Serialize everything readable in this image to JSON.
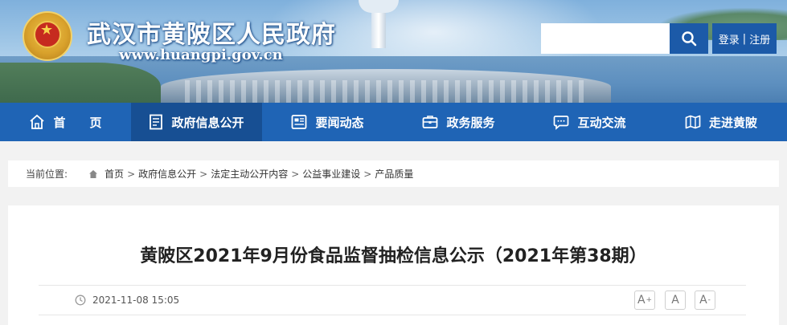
{
  "header": {
    "site_title": "武汉市黄陂区人民政府",
    "site_url": "www.huangpi.gov.cn",
    "search": {
      "value": "",
      "placeholder": ""
    },
    "login_label": "登录",
    "separator": "|",
    "register_label": "注册"
  },
  "nav": {
    "items": [
      {
        "label": "首页",
        "icon": "home-icon",
        "active": false
      },
      {
        "label": "政府信息公开",
        "icon": "document-icon",
        "active": true
      },
      {
        "label": "要闻动态",
        "icon": "news-icon",
        "active": false
      },
      {
        "label": "政务服务",
        "icon": "briefcase-icon",
        "active": false
      },
      {
        "label": "互动交流",
        "icon": "chat-bubble-icon",
        "active": false
      },
      {
        "label": "走进黄陂",
        "icon": "map-icon",
        "active": false
      }
    ]
  },
  "breadcrumb": {
    "prefix": "当前位置:",
    "items": [
      "首页",
      "政府信息公开",
      "法定主动公开内容",
      "公益事业建设",
      "产品质量"
    ],
    "separator": ">"
  },
  "article": {
    "title": "黄陂区2021年9月份食品监督抽检信息公示（2021年第38期）",
    "date": "2021-11-08 15:05",
    "font_buttons": {
      "larger": "A",
      "larger_mark": "+",
      "normal": "A",
      "smaller": "A",
      "smaller_mark": "-"
    }
  },
  "colors": {
    "nav_bg": "#1f64b5",
    "nav_active_bg": "#174f93",
    "header_button_bg": "#1c5aa8",
    "page_bg": "#f2f2f2"
  }
}
